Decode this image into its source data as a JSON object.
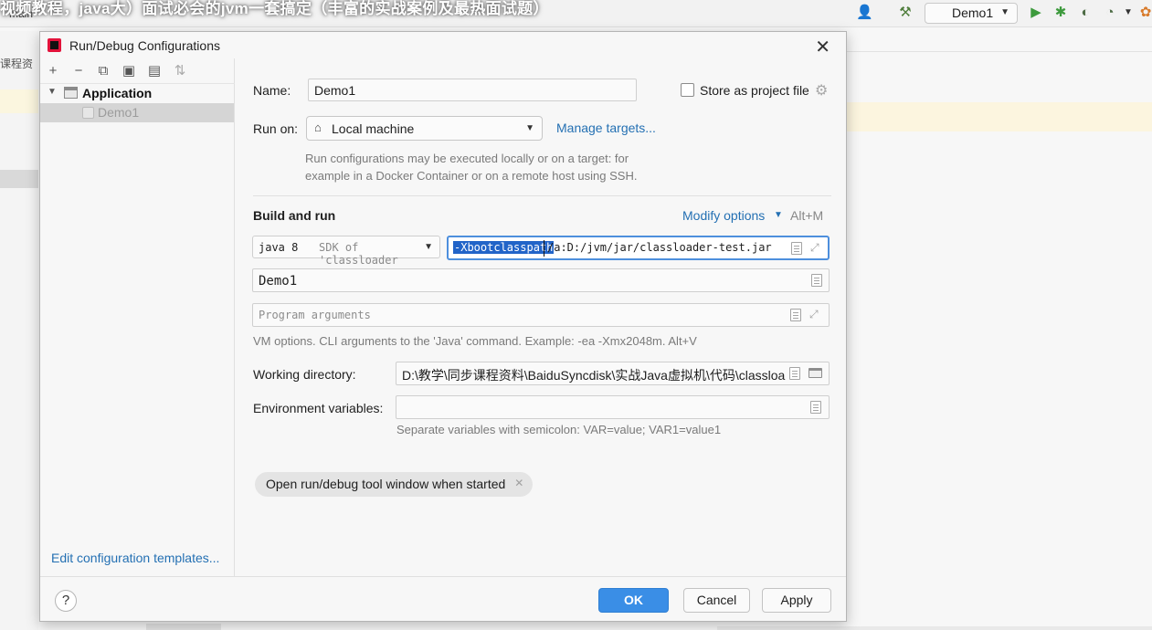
{
  "overlay": {
    "title": "视频教程，java大）面试必会的jvm一套搞定（丰富的实战案例及最热面试题）",
    "small_label": "main",
    "side_text": "课程资"
  },
  "ide_toolbar": {
    "run_config": "Demo1"
  },
  "dialog": {
    "title": "Run/Debug Configurations",
    "left_toolbar": [
      "+",
      "−",
      "copy",
      "save",
      "folder",
      "sort"
    ],
    "tree": {
      "group_label": "Application",
      "item_label": "Demo1"
    },
    "edit_templates_link": "Edit configuration templates...",
    "form": {
      "name_label": "Name:",
      "name_value": "Demo1",
      "store_label": "Store as project file",
      "store_checked": false,
      "run_on_label": "Run on:",
      "run_on_value": "Local machine",
      "manage_targets": "Manage targets...",
      "run_on_hint_1": "Run configurations may be executed locally or on a target: for",
      "run_on_hint_2": "example in a Docker Container or on a remote host using SSH.",
      "build_run_title": "Build and run",
      "modify_options": "Modify options",
      "modify_shortcut": "Alt+M",
      "jdk_main": "java 8",
      "jdk_sub": "SDK of 'classloader",
      "vm_selected": "-Xbootclasspath",
      "vm_rest": "/a:D:/jvm/jar/classloader-test.jar",
      "main_class": "Demo1",
      "program_args_placeholder": "Program arguments",
      "vm_hint": "VM options. CLI arguments to the 'Java' command. Example: -ea -Xmx2048m. Alt+V",
      "workdir_label": "Working directory:",
      "workdir_value": "D:\\教学\\同步课程资料\\BaiduSyncdisk\\实战Java虚拟机\\代码\\classloader",
      "envvars_label": "Environment variables:",
      "envvars_value": "",
      "env_hint": "Separate variables with semicolon: VAR=value; VAR1=value1",
      "tool_window_chip": "Open run/debug tool window when started"
    },
    "footer": {
      "help": "?",
      "ok": "OK",
      "cancel": "Cancel",
      "apply": "Apply"
    }
  },
  "colors": {
    "accent": "#3a8ee6",
    "link": "#2470b3",
    "selection": "#2264c8"
  }
}
